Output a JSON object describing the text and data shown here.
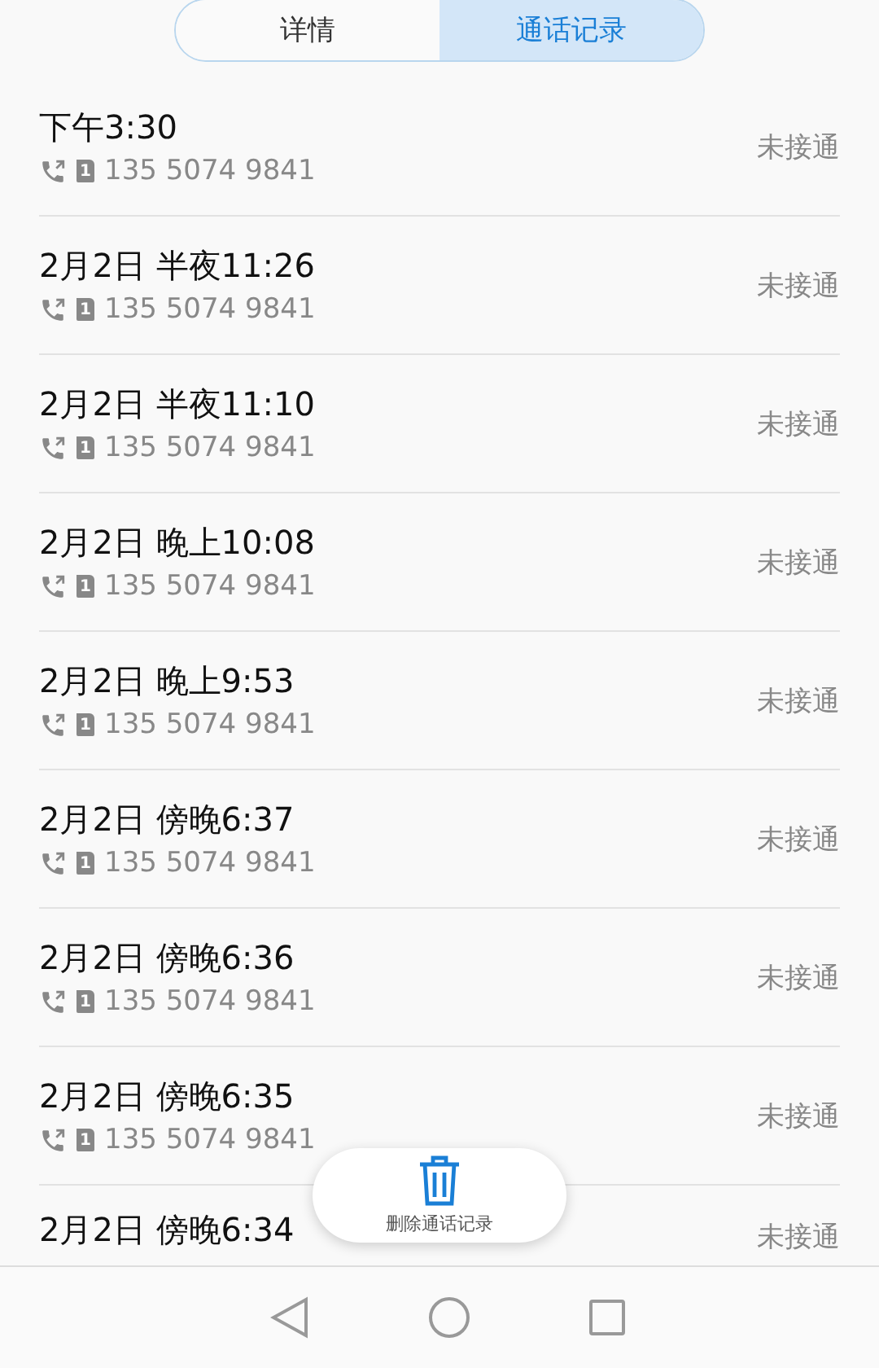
{
  "tabs": [
    {
      "label": "详情",
      "selected": false
    },
    {
      "label": "通话记录",
      "selected": true
    }
  ],
  "calls": [
    {
      "time": "下午3:30",
      "sim": "1",
      "number": "135 5074 9841",
      "status": "未接通"
    },
    {
      "time": "2月2日 半夜11:26",
      "sim": "1",
      "number": "135 5074 9841",
      "status": "未接通"
    },
    {
      "time": "2月2日 半夜11:10",
      "sim": "1",
      "number": "135 5074 9841",
      "status": "未接通"
    },
    {
      "time": "2月2日 晚上10:08",
      "sim": "1",
      "number": "135 5074 9841",
      "status": "未接通"
    },
    {
      "time": "2月2日 晚上9:53",
      "sim": "1",
      "number": "135 5074 9841",
      "status": "未接通"
    },
    {
      "time": "2月2日 傍晚6:37",
      "sim": "1",
      "number": "135 5074 9841",
      "status": "未接通"
    },
    {
      "time": "2月2日 傍晚6:36",
      "sim": "1",
      "number": "135 5074 9841",
      "status": "未接通"
    },
    {
      "time": "2月2日 傍晚6:35",
      "sim": "1",
      "number": "135 5074 9841",
      "status": "未接通"
    },
    {
      "time": "2月2日 傍晚6:34",
      "status": "未接通"
    }
  ],
  "delete_button": {
    "label": "删除通话记录"
  }
}
